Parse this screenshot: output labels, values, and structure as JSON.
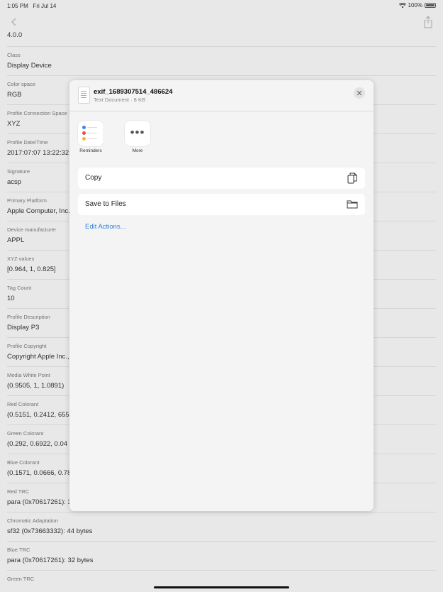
{
  "status": {
    "time": "1:05 PM",
    "date": "Fri Jul 14",
    "battery": "100%"
  },
  "nav": {
    "back_icon": "chevron-left-icon",
    "share_icon": "share-icon"
  },
  "list": {
    "first_value": "4.0.0",
    "rows": [
      {
        "label": "Class",
        "value": "Display Device"
      },
      {
        "label": "Color space",
        "value": "RGB"
      },
      {
        "label": "Profile Connection Space",
        "value": "XYZ"
      },
      {
        "label": "Profile Date/Time",
        "value": "2017:07:07 13:22:32"
      },
      {
        "label": "Signature",
        "value": "acsp"
      },
      {
        "label": "Primary Platform",
        "value": "Apple Computer, Inc."
      },
      {
        "label": "Device manufacturer",
        "value": "APPL"
      },
      {
        "label": "XYZ values",
        "value": "[0.964, 1, 0.825]"
      },
      {
        "label": "Tag Count",
        "value": "10"
      },
      {
        "label": "Profile Description",
        "value": "Display P3"
      },
      {
        "label": "Profile Copyright",
        "value": "Copyright Apple Inc.,"
      },
      {
        "label": "Media White Point",
        "value": "(0.9505, 1, 1.0891)"
      },
      {
        "label": "Red Colorant",
        "value": "(0.5151, 0.2412, 6553"
      },
      {
        "label": "Green Colorant",
        "value": "(0.292, 0.6922, 0.04"
      },
      {
        "label": "Blue Colorant",
        "value": "(0.1571, 0.0666, 0.78"
      },
      {
        "label": "Red TRC",
        "value": "para (0x70617261): 3"
      },
      {
        "label": "Chromatic Adaptation",
        "value": "sf32 (0x73663332): 44 bytes"
      },
      {
        "label": "Blue TRC",
        "value": "para (0x70617261): 32 bytes"
      },
      {
        "label": "Green TRC",
        "value": ""
      }
    ]
  },
  "share_sheet": {
    "file_name": "exif_1689307514_486624",
    "file_subtitle": "Text Document · 8 KB",
    "close_icon": "close-icon",
    "apps": [
      {
        "label": "Reminders",
        "icon": "reminders-icon"
      },
      {
        "label": "More",
        "icon": "more-icon"
      }
    ],
    "actions": [
      {
        "label": "Copy",
        "icon": "copy-icon"
      },
      {
        "label": "Save to Files",
        "icon": "folder-icon"
      }
    ],
    "edit_actions": "Edit Actions...",
    "colors": {
      "link": "#2f7fd8",
      "reminder_dots": [
        "#3a86e8",
        "#e84d4d",
        "#f2b632"
      ]
    }
  }
}
